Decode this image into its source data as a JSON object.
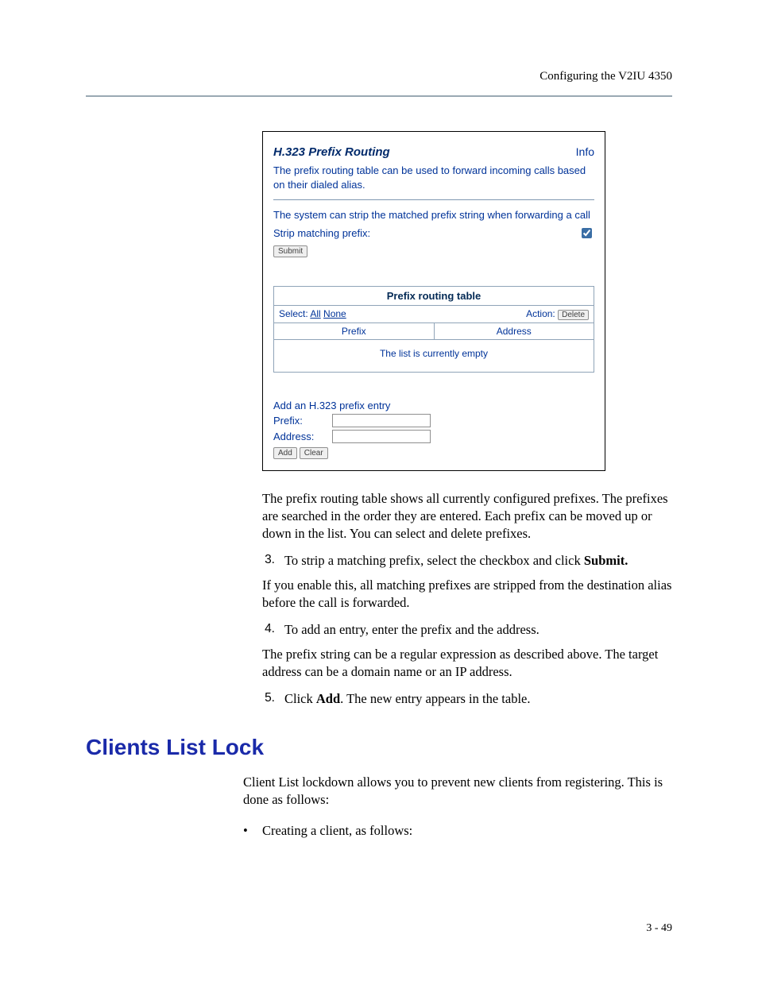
{
  "header": {
    "running": "Configuring the V2IU 4350"
  },
  "shot": {
    "title": "H.323 Prefix Routing",
    "info": "Info",
    "desc1": "The prefix routing table can be used to forward incoming calls based on their dialed alias.",
    "desc2": "The system can strip the matched prefix string when forwarding a call",
    "strip_label": "Strip matching prefix:",
    "strip_checked": true,
    "submit": "Submit",
    "table": {
      "title": "Prefix routing table",
      "select_label": "Select:",
      "all": "All",
      "none": "None",
      "action_label": "Action:",
      "delete": "Delete",
      "col_prefix": "Prefix",
      "col_address": "Address",
      "empty": "The list is currently empty"
    },
    "add": {
      "heading": "Add an H.323 prefix entry",
      "prefix_label": "Prefix:",
      "address_label": "Address:",
      "prefix_value": "",
      "address_value": "",
      "add": "Add",
      "clear": "Clear"
    }
  },
  "body": {
    "p1": "The prefix routing table shows all currently configured prefixes. The prefixes are searched in the order they are entered. Each prefix can be moved up or down in the list. You can select and delete prefixes.",
    "step3_a": "To strip a matching prefix, select the checkbox and click ",
    "step3_b": "Submit.",
    "step3_sub": "If you enable this, all matching prefixes are stripped from the destination alias before the call is forwarded.",
    "step4": "To add an entry, enter the prefix and the address.",
    "step4_sub": "The prefix string can be a regular expression as described above. The target address can be a domain name or an IP address.",
    "step5_a": "Click ",
    "step5_b": "Add",
    "step5_c": ". The new entry appears in the table."
  },
  "section": {
    "title": "Clients List Lock",
    "p1": "Client List lockdown allows you to prevent new clients from registering. This is done as follows:",
    "bullet1": "Creating a client, as follows:"
  },
  "footer": {
    "pg": "3 - 49"
  }
}
